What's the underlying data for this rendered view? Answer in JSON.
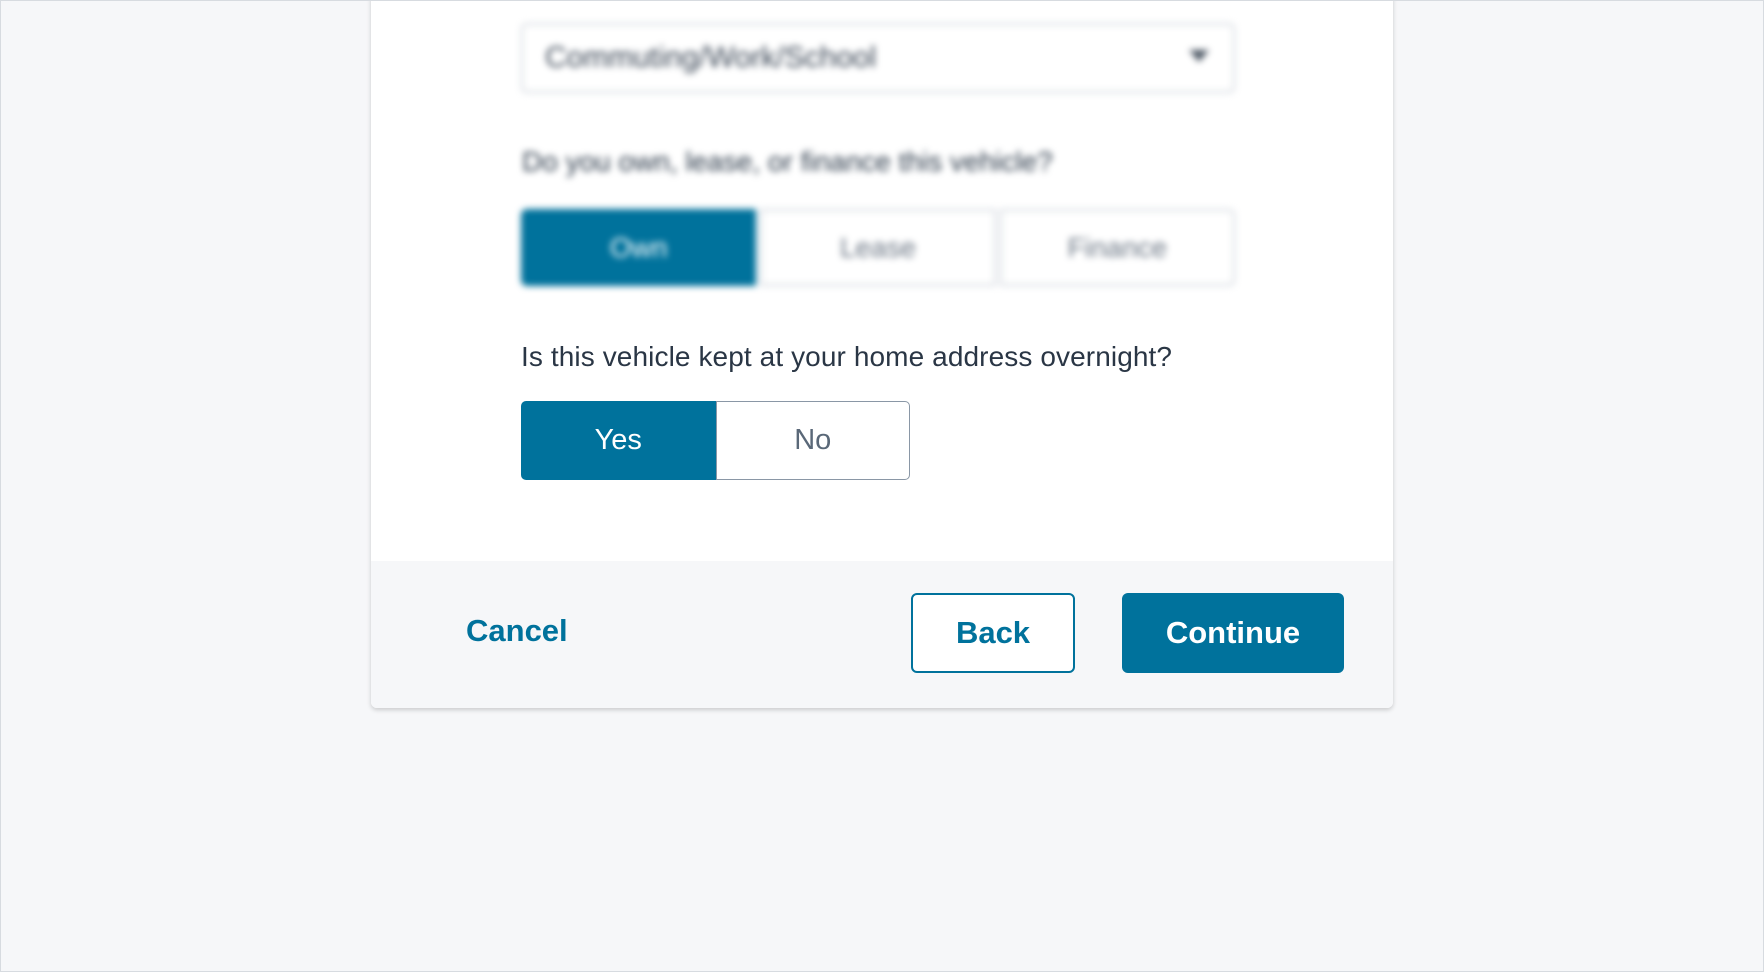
{
  "form": {
    "usage_select": {
      "value": "Commuting/Work/School"
    },
    "ownership_question": "Do you own, lease, or finance this vehicle?",
    "ownership_options": [
      "Own",
      "Lease",
      "Finance"
    ],
    "ownership_selected": "Own",
    "overnight_question": "Is this vehicle kept at your home address overnight?",
    "overnight_options": {
      "yes": "Yes",
      "no": "No"
    },
    "overnight_selected": "Yes"
  },
  "footer": {
    "cancel_label": "Cancel",
    "back_label": "Back",
    "continue_label": "Continue"
  },
  "colors": {
    "accent": "#00729c",
    "page_background": "#f6f7f9",
    "card_background": "#ffffff"
  }
}
